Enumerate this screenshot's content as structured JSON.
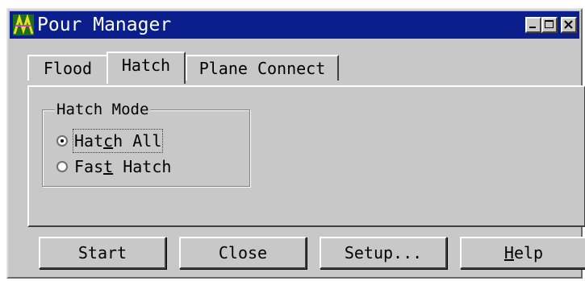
{
  "window": {
    "title": "Pour Manager",
    "title_bar_color": "#0a1e8c",
    "controls": [
      "minimize-icon",
      "maximize-icon",
      "close-icon"
    ]
  },
  "tabs": [
    {
      "label": "Flood",
      "selected": false
    },
    {
      "label": "Hatch",
      "selected": true
    },
    {
      "label": "Plane Connect",
      "selected": false
    }
  ],
  "hatch_mode": {
    "label": "Hatch Mode",
    "options": [
      {
        "label": "Hatch All",
        "pre": "Hat",
        "accel": "c",
        "post": "h All",
        "selected": true,
        "focused": true
      },
      {
        "label": "Fast Hatch",
        "pre": "Fas",
        "accel": "t",
        "post": " Hatch",
        "selected": false,
        "focused": false
      }
    ]
  },
  "buttons": {
    "start": "Start",
    "close": "Close",
    "setup": "Setup...",
    "help": {
      "label": "Help",
      "accel": "H",
      "rest": "elp"
    }
  }
}
